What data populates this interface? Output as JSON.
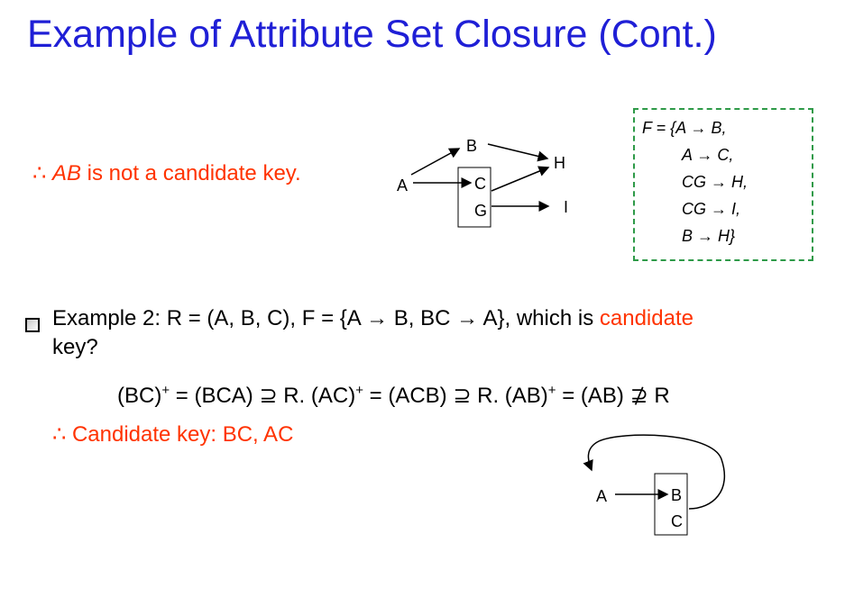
{
  "title": "Example of Attribute Set Closure (Cont.)",
  "line1": {
    "therefore": "∴",
    "ab": "AB",
    "rest": "is not a candidate key."
  },
  "diagram1": {
    "a": "A",
    "b": "B",
    "c": "C",
    "g": "G",
    "h": "H",
    "i": "I"
  },
  "fset": {
    "line1": "F = {A → B,",
    "line2": "A → C,",
    "line3": "CG → H,",
    "line4": "CG → I,",
    "line5": "B → H}"
  },
  "example2": {
    "part1": "Example 2: R = (A, B, C), F = {A → B, BC → A}, which is",
    "highlight": "candidate",
    "part2": "key?"
  },
  "closure": {
    "bc": "(BC)",
    "bc_eq": " = (BCA) ⊇ R. ",
    "ac": "(AC)",
    "ac_eq": " = (ACB) ⊇ R. ",
    "ab": "(AB)",
    "ab_eq": " = (AB) ⊉ R",
    "plus": "+"
  },
  "candidate_key": "∴ Candidate key: BC, AC",
  "diagram2": {
    "a": "A",
    "b": "B",
    "c": "C"
  },
  "colors": {
    "title": "#1f1fd6",
    "highlight": "#ff3300",
    "box_border": "#2e9a48"
  }
}
